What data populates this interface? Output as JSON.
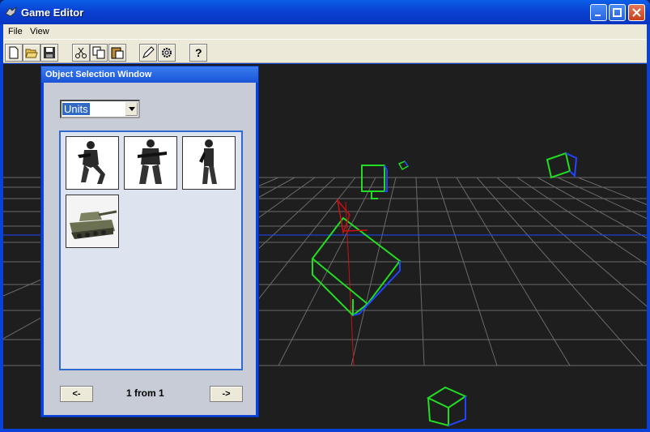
{
  "window": {
    "title": "Game Editor"
  },
  "menu": [
    "File",
    "View"
  ],
  "toolbar": {
    "icons": [
      "new-file-icon",
      "open-folder-icon",
      "save-icon",
      "cut-icon",
      "copy-icon",
      "paste-icon",
      "edit-icon",
      "settings-icon",
      "help-icon"
    ]
  },
  "panel": {
    "title": "Object Selection Window",
    "category": "Units",
    "items": [
      "soldier-crouching",
      "soldier-standing-rifle",
      "soldier-side",
      "tank"
    ],
    "prev_label": "<-",
    "next_label": "->",
    "page_label": "1 from 1"
  },
  "colors": {
    "accent": "#0a44d8",
    "viewport_bg": "#1e1e1e",
    "grid": "#6a6a6a",
    "gizmo_green": "#22dd22",
    "gizmo_blue": "#2244ff",
    "axis_red": "#cc1010"
  }
}
